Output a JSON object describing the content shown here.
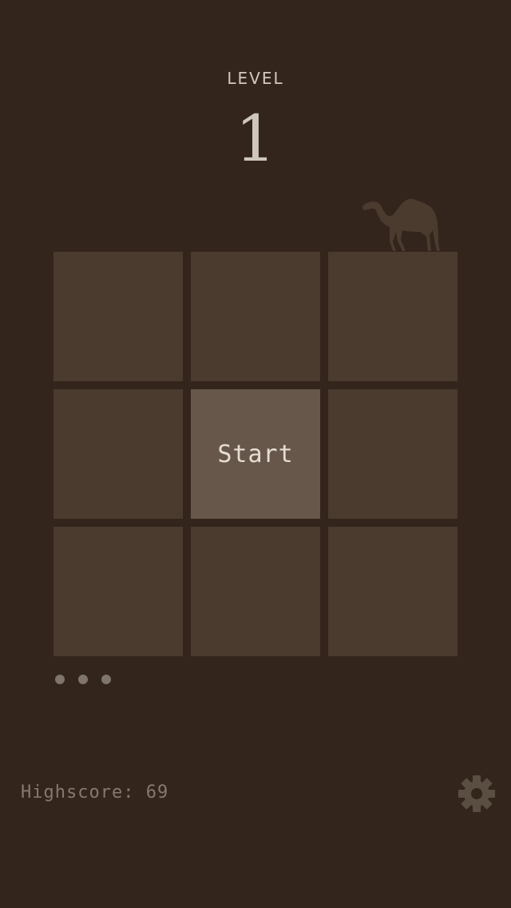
{
  "level": {
    "label": "LEVEL",
    "number": "1"
  },
  "grid": {
    "start_label": "Start"
  },
  "pagination": {
    "count": 3
  },
  "footer": {
    "highscore_text": "Highscore: 69"
  },
  "icons": {
    "camel": "camel-icon",
    "settings": "gear-icon"
  },
  "colors": {
    "background": "#33251b",
    "tile": "#4b3a2e",
    "start_tile": "#67574a",
    "camel": "#4b3a2e",
    "gear": "#5a4d42"
  }
}
